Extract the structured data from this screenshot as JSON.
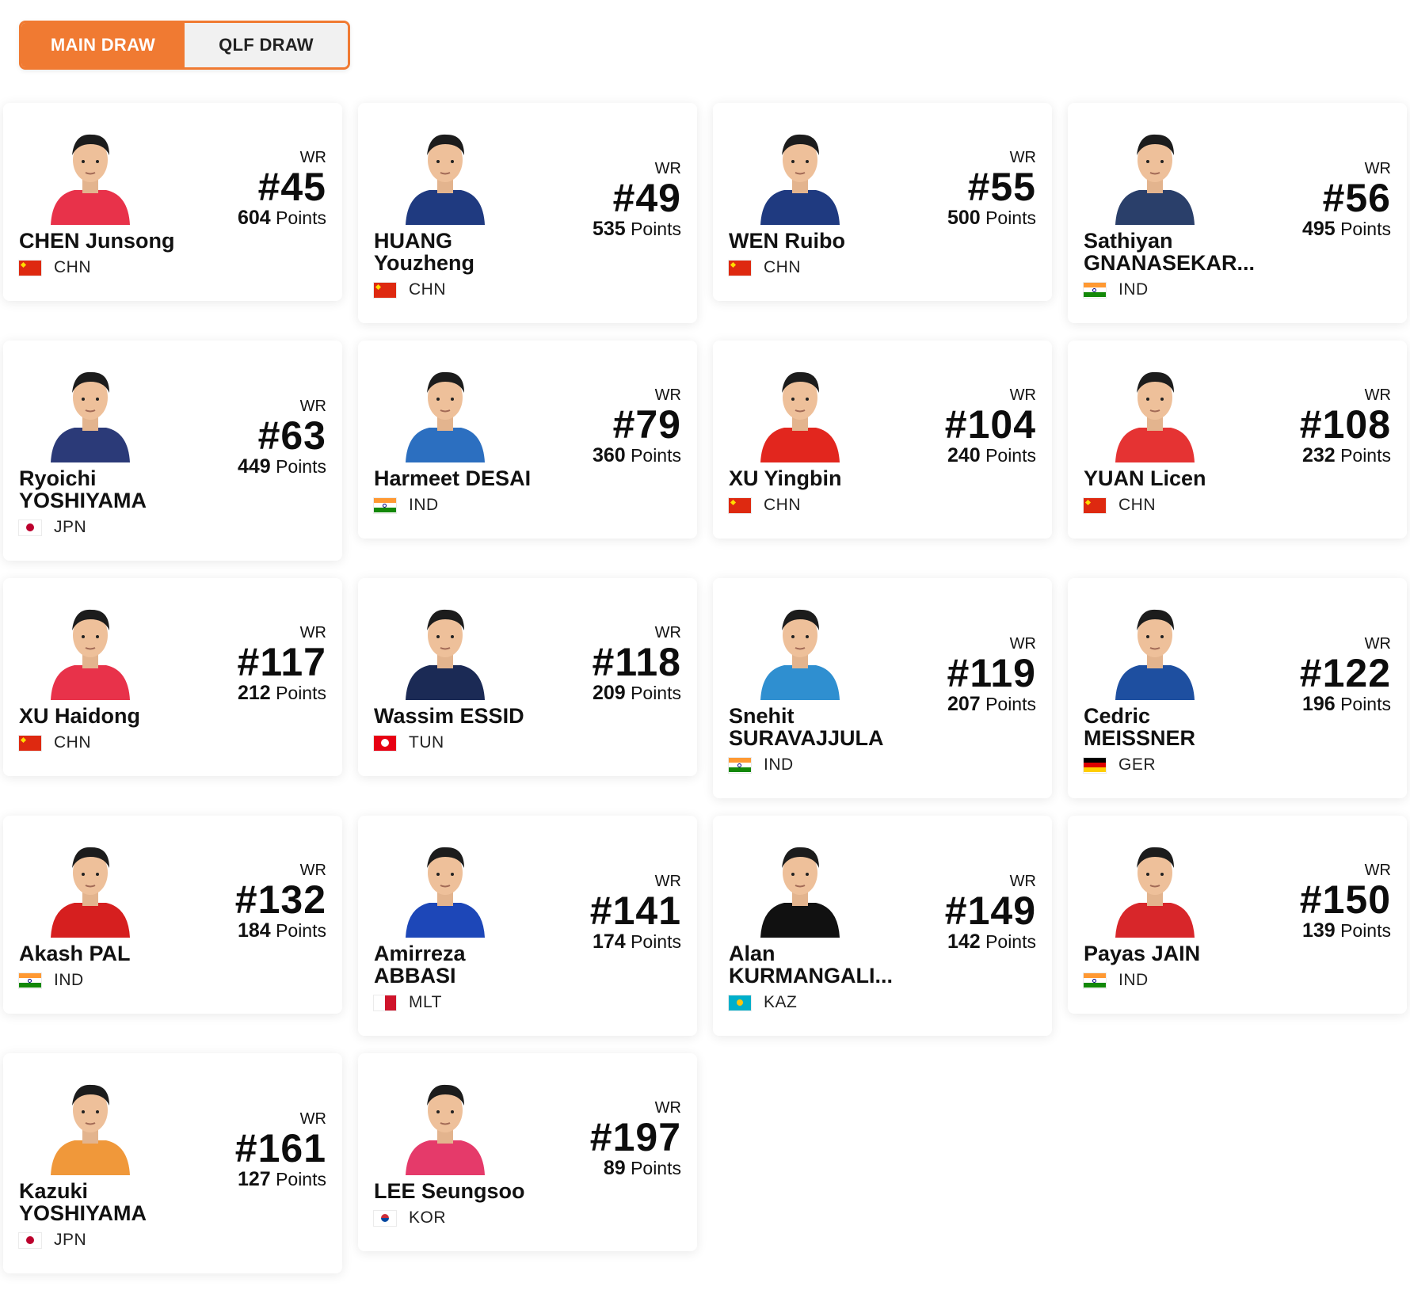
{
  "tabs": [
    {
      "label": "MAIN DRAW",
      "active": true
    },
    {
      "label": "QLF DRAW",
      "active": false
    }
  ],
  "colors": {
    "accent": "#f07a32"
  },
  "wr_label": "WR",
  "points_label": "Points",
  "players": [
    {
      "name": "CHEN Junsong",
      "country": "CHN",
      "rank": "#45",
      "points": "604",
      "shirt": "#e8324a"
    },
    {
      "name": "HUANG\nYouzheng",
      "country": "CHN",
      "rank": "#49",
      "points": "535",
      "shirt": "#1f3a80"
    },
    {
      "name": "WEN Ruibo",
      "country": "CHN",
      "rank": "#55",
      "points": "500",
      "shirt": "#1f3a80"
    },
    {
      "name": "Sathiyan\nGNANASEKAR...",
      "country": "IND",
      "rank": "#56",
      "points": "495",
      "shirt": "#2a3f6a"
    },
    {
      "name": "Ryoichi\nYOSHIYAMA",
      "country": "JPN",
      "rank": "#63",
      "points": "449",
      "shirt": "#2b3a78"
    },
    {
      "name": "Harmeet DESAI",
      "country": "IND",
      "rank": "#79",
      "points": "360",
      "shirt": "#2c6fc0"
    },
    {
      "name": "XU Yingbin",
      "country": "CHN",
      "rank": "#104",
      "points": "240",
      "shirt": "#e2261e"
    },
    {
      "name": "YUAN Licen",
      "country": "CHN",
      "rank": "#108",
      "points": "232",
      "shirt": "#e53333"
    },
    {
      "name": "XU Haidong",
      "country": "CHN",
      "rank": "#117",
      "points": "212",
      "shirt": "#e8324a"
    },
    {
      "name": "Wassim ESSID",
      "country": "TUN",
      "rank": "#118",
      "points": "209",
      "shirt": "#1b2a55"
    },
    {
      "name": "Snehit\nSURAVAJJULA",
      "country": "IND",
      "rank": "#119",
      "points": "207",
      "shirt": "#2f8fd0"
    },
    {
      "name": "Cedric\nMEISSNER",
      "country": "GER",
      "rank": "#122",
      "points": "196",
      "shirt": "#1e4fa0"
    },
    {
      "name": "Akash PAL",
      "country": "IND",
      "rank": "#132",
      "points": "184",
      "shirt": "#d61f1f"
    },
    {
      "name": "Amirreza\nABBASI",
      "country": "MLT",
      "rank": "#141",
      "points": "174",
      "shirt": "#1d47b8"
    },
    {
      "name": "Alan\nKURMANGALI...",
      "country": "KAZ",
      "rank": "#149",
      "points": "142",
      "shirt": "#111111"
    },
    {
      "name": "Payas JAIN",
      "country": "IND",
      "rank": "#150",
      "points": "139",
      "shirt": "#d8262a"
    },
    {
      "name": "Kazuki\nYOSHIYAMA",
      "country": "JPN",
      "rank": "#161",
      "points": "127",
      "shirt": "#f0983a"
    },
    {
      "name": "LEE Seungsoo",
      "country": "KOR",
      "rank": "#197",
      "points": "89",
      "shirt": "#e53a6a"
    }
  ]
}
